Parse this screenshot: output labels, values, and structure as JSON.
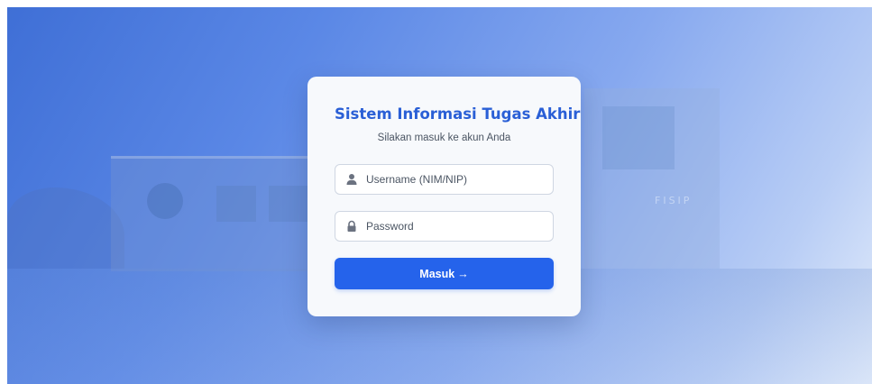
{
  "login": {
    "title": "Sistem Informasi Tugas Akhir",
    "subtitle": "Silakan masuk ke akun Anda",
    "username": {
      "placeholder": "Username (NIM/NIP)",
      "value": "",
      "icon": "user-icon"
    },
    "password": {
      "placeholder": "Password",
      "value": "",
      "icon": "lock-icon"
    },
    "submit": {
      "label": "Masuk",
      "icon": "arrow-right-icon",
      "arrow": "→"
    }
  },
  "background": {
    "sign_text": "FISIP"
  },
  "colors": {
    "accent": "#2563eb",
    "title": "#2a5fd6",
    "card_background": "#f7f9fc",
    "page_gradient_start": "#3f6fd6",
    "page_gradient_end": "#e4edfb"
  }
}
